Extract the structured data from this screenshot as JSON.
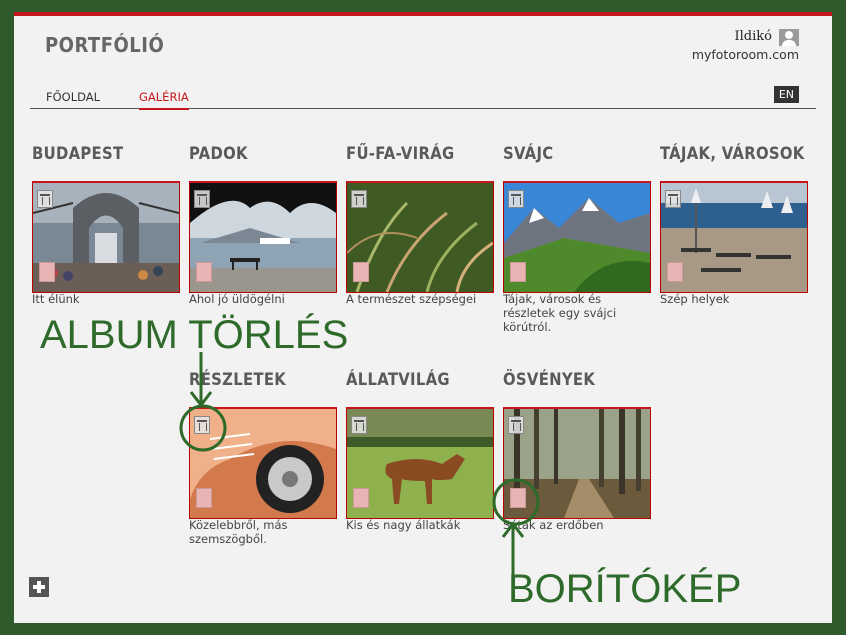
{
  "header": {
    "brand": "PORTFÓLIÓ",
    "user_name": "Ildikó",
    "site": "myfotoroom.com"
  },
  "nav": {
    "home": "FŐOLDAL",
    "gallery": "GALÉRIA",
    "lang": "EN"
  },
  "albums": [
    {
      "title": "BUDAPEST",
      "caption": "Itt élünk"
    },
    {
      "title": "PADOK",
      "caption": "Ahol jó üldögélni"
    },
    {
      "title": "FŰ-FA-VIRÁG",
      "caption": "A természet szépségei"
    },
    {
      "title": "SVÁJC",
      "caption": "Tájak, városok és részletek egy svájci körútról."
    },
    {
      "title": "TÁJAK, VÁROSOK",
      "caption": "Szép helyek"
    },
    {
      "title": "RÉSZLETEK",
      "caption": "Közelebbről, más szemszögből."
    },
    {
      "title": "ÁLLATVILÁG",
      "caption": "Kis és nagy állatkák"
    },
    {
      "title": "ÖSVÉNYEK",
      "caption": "Séták az erdőben"
    }
  ],
  "annotations": {
    "delete": "ALBUM TÖRLÉS",
    "cover": "BORÍTÓKÉP"
  },
  "colors": {
    "accent": "#c8161d",
    "annotation": "#2e6a2a",
    "frame": "#2f5a2b"
  },
  "icons": {
    "trash": "trash-icon",
    "cover": "cover-image-icon",
    "add": "plus-icon",
    "user": "user-icon"
  }
}
